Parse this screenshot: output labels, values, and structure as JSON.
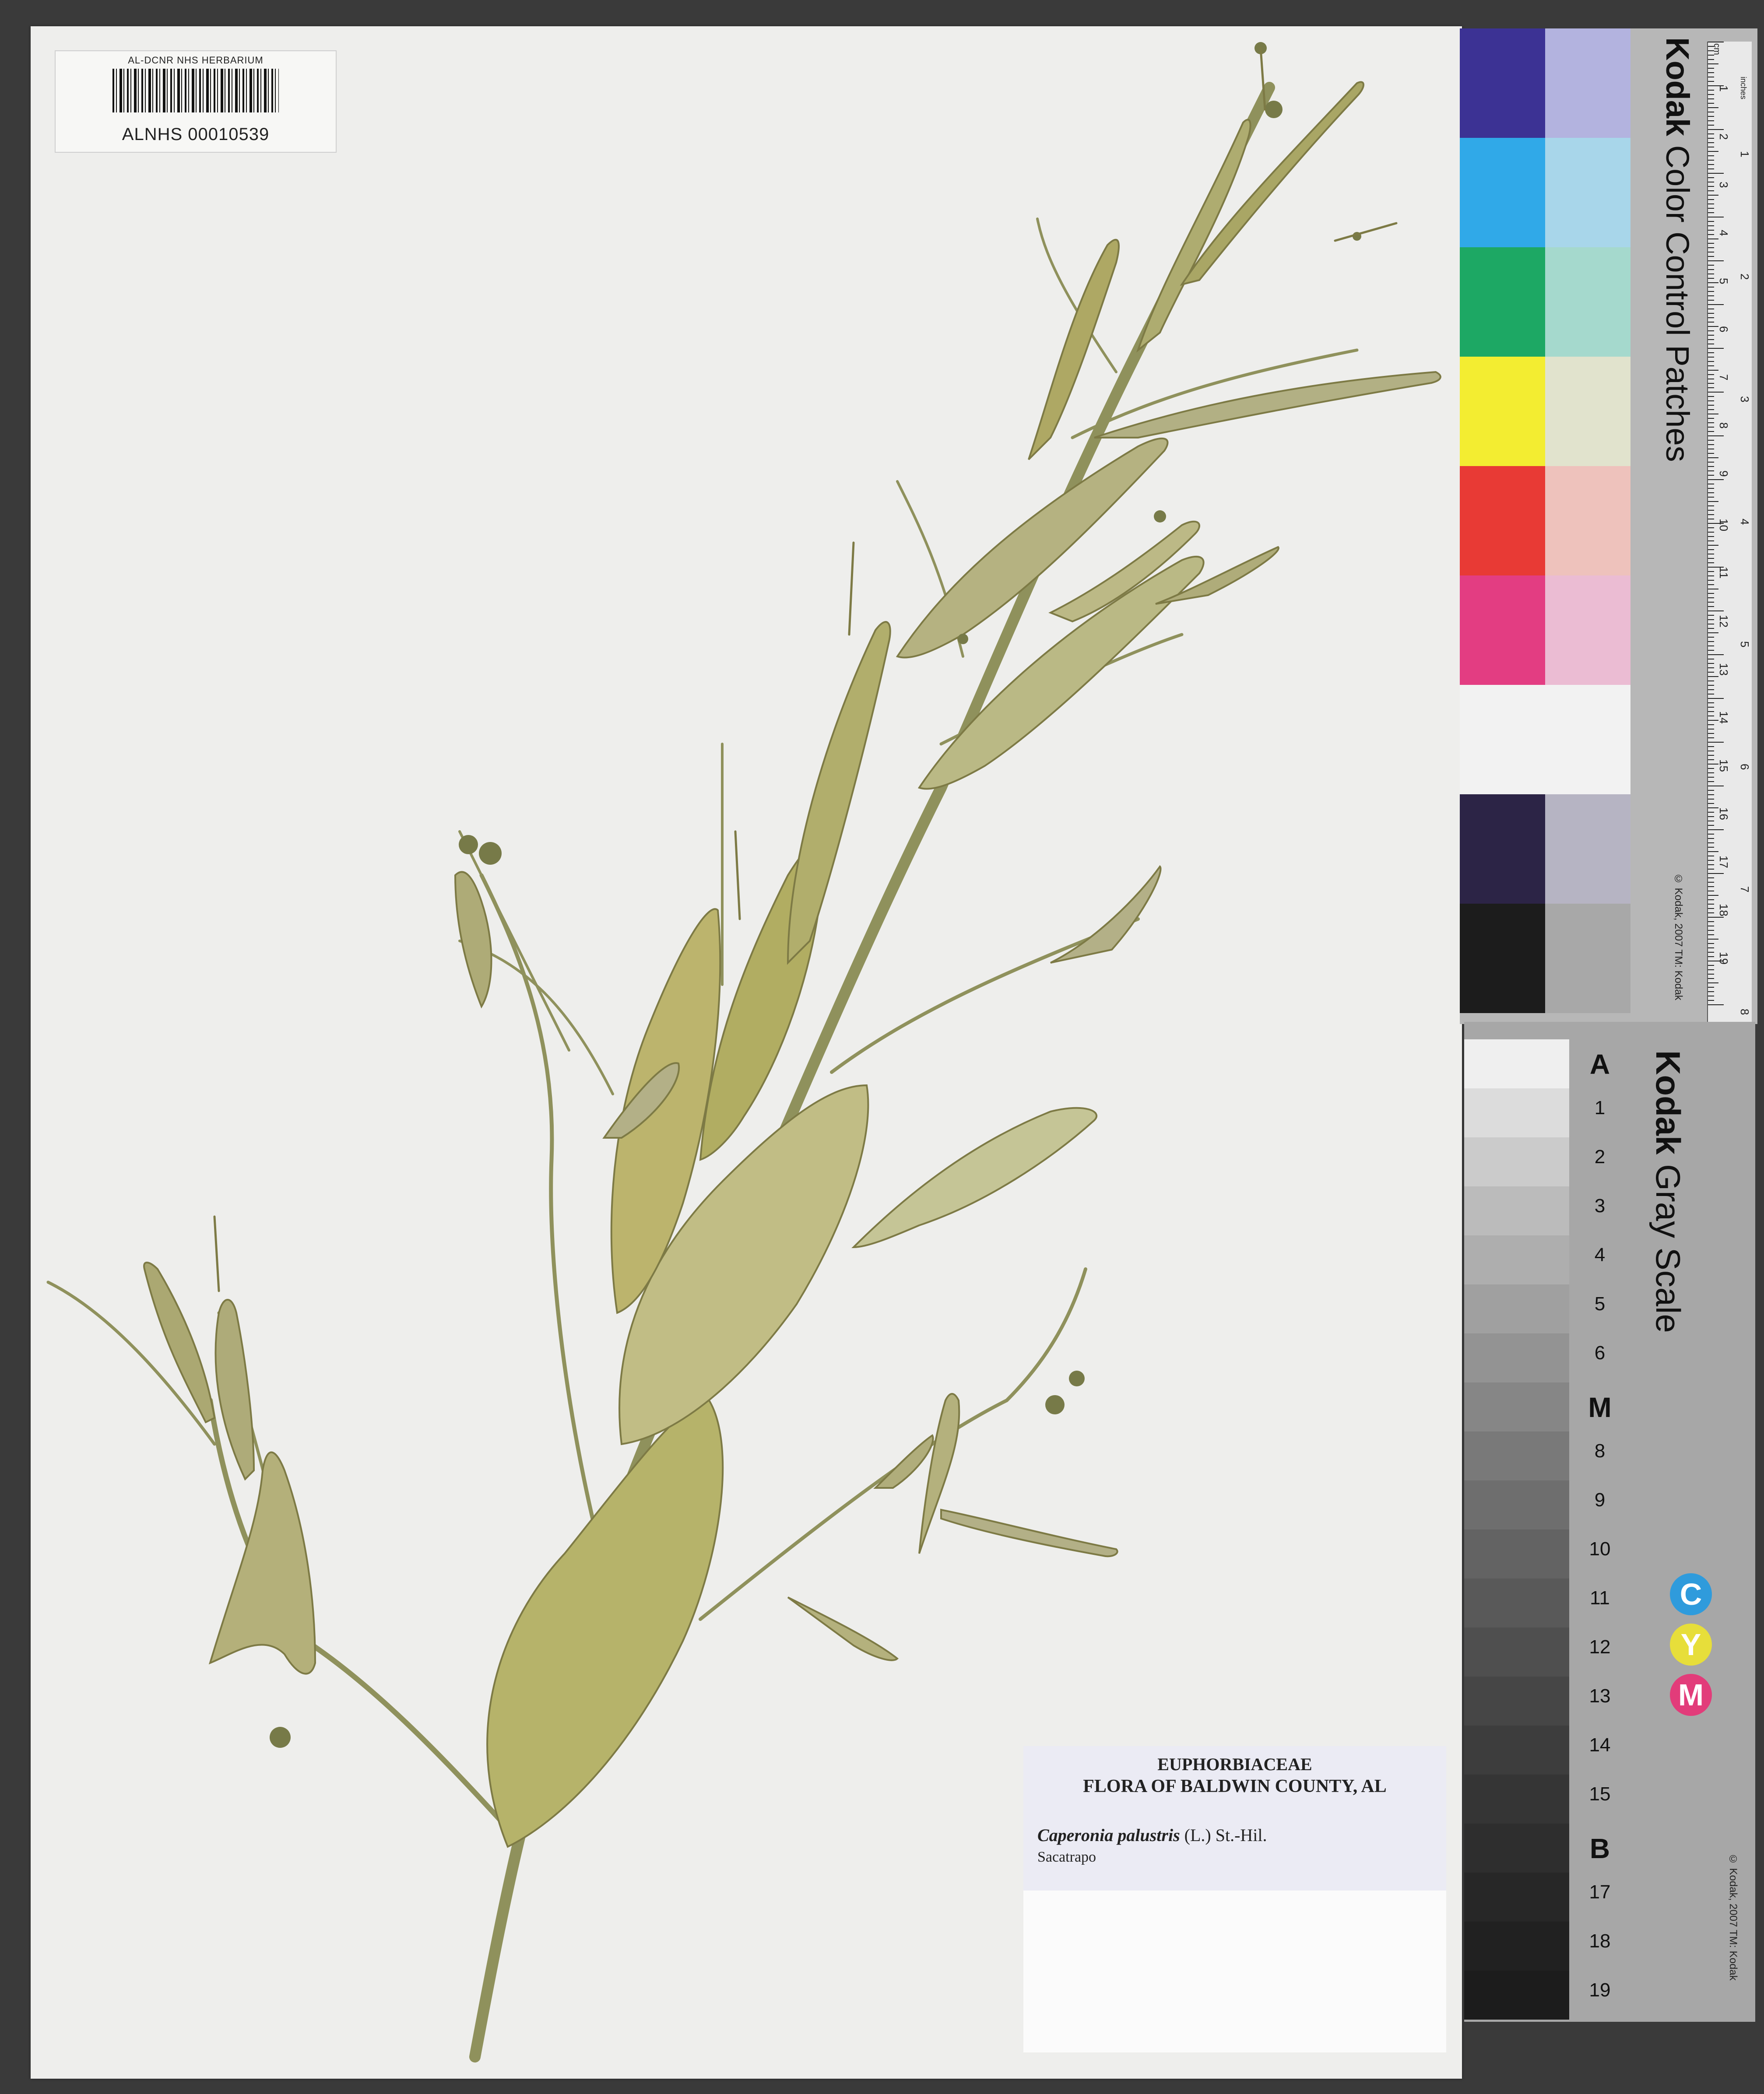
{
  "barcode": {
    "herbarium": "AL-DCNR NHS HERBARIUM",
    "number": "ALNHS 00010539"
  },
  "label": {
    "family": "EUPHORBIACEAE",
    "flora": "FLORA OF BALDWIN COUNTY, AL",
    "taxon_name": "Caperonia palustris",
    "taxon_author": "(L.) St.-Hil.",
    "common_name": "Sacatrapo"
  },
  "color_card": {
    "brand": "Kodak",
    "title": "Color Control Patches",
    "patches": [
      {
        "label": "Blue",
        "dark": "#3c3294",
        "light": "#b3b3df"
      },
      {
        "label": "Cyan",
        "dark": "#30a9e8",
        "light": "#a8d6ea"
      },
      {
        "label": "Green",
        "dark": "#1da864",
        "light": "#a5d9cd"
      },
      {
        "label": "Yellow",
        "dark": "#f3ed31",
        "light": "#e1e3cd"
      },
      {
        "label": "Red",
        "dark": "#e83a35",
        "light": "#eec2bc"
      },
      {
        "label": "Magenta",
        "dark": "#e33d82",
        "light": "#ebbcd3"
      },
      {
        "label": "White",
        "dark": "#f2f2f2",
        "light": "#f2f2f2"
      },
      {
        "label": "3/Color",
        "dark": "#2c2446",
        "light": "#b6b4c3"
      },
      {
        "label": "Black",
        "dark": "#1c1c1c",
        "light": "#a8a8a8"
      }
    ],
    "ruler_unit_cm": "cm",
    "ruler_unit_in": "inches",
    "cm_marks": [
      "1",
      "2",
      "3",
      "4",
      "5",
      "6",
      "7",
      "8",
      "9",
      "10",
      "11",
      "12",
      "13",
      "14",
      "15",
      "16",
      "17",
      "18",
      "19"
    ],
    "inch_marks": [
      "1",
      "2",
      "3",
      "4",
      "5",
      "6",
      "7",
      "8"
    ],
    "copyright": "© Kodak, 2007 TM: Kodak"
  },
  "gray_card": {
    "brand": "Kodak",
    "title": "Gray Scale",
    "labels": [
      "A",
      "1",
      "2",
      "3",
      "4",
      "5",
      "6",
      "M",
      "8",
      "9",
      "10",
      "11",
      "12",
      "13",
      "14",
      "15",
      "B",
      "17",
      "18",
      "19"
    ],
    "steps": [
      "#efefef",
      "#dcdcdc",
      "#cbcbcb",
      "#bbbbbb",
      "#aeaeae",
      "#a0a0a0",
      "#939393",
      "#868686",
      "#797979",
      "#6e6e6e",
      "#636363",
      "#595959",
      "#4f4f4f",
      "#464646",
      "#3d3d3d",
      "#353535",
      "#2e2e2e",
      "#272727",
      "#212121",
      "#1c1c1c"
    ],
    "cym": [
      {
        "letter": "C",
        "color": "#2f9bdc"
      },
      {
        "letter": "Y",
        "color": "#e7de3a"
      },
      {
        "letter": "M",
        "color": "#e23c7a"
      }
    ],
    "copyright": "© Kodak, 2007 TM: Kodak"
  },
  "colors": {
    "sheet": "#eeeeec",
    "leaf": "#b4b072",
    "leaf_dark": "#8d8b52",
    "stem": "#8f915c"
  }
}
